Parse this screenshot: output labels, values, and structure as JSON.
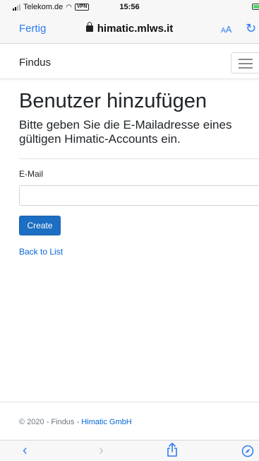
{
  "status_bar": {
    "carrier": "Telekom.de",
    "vpn": "VPN",
    "time": "15:56"
  },
  "browser": {
    "done_label": "Fertig",
    "address": "himatic.mlws.it",
    "aa_small": "A",
    "aa_large": "A"
  },
  "navbar": {
    "brand": "Findus"
  },
  "page": {
    "title": "Benutzer hinzufügen",
    "lead": "Bitte geben Sie die E-Mailadresse eines gültigen Himatic-Accounts ein.",
    "email_label": "E-Mail",
    "email_value": "",
    "create_label": "Create",
    "back_label": "Back to List"
  },
  "footer": {
    "prefix": "© 2020 - Findus - ",
    "company": "Himatic GmbH"
  },
  "colors": {
    "ios_blue": "#2d7cf6",
    "primary_button": "#1b6ec2",
    "link": "#0366d6"
  }
}
